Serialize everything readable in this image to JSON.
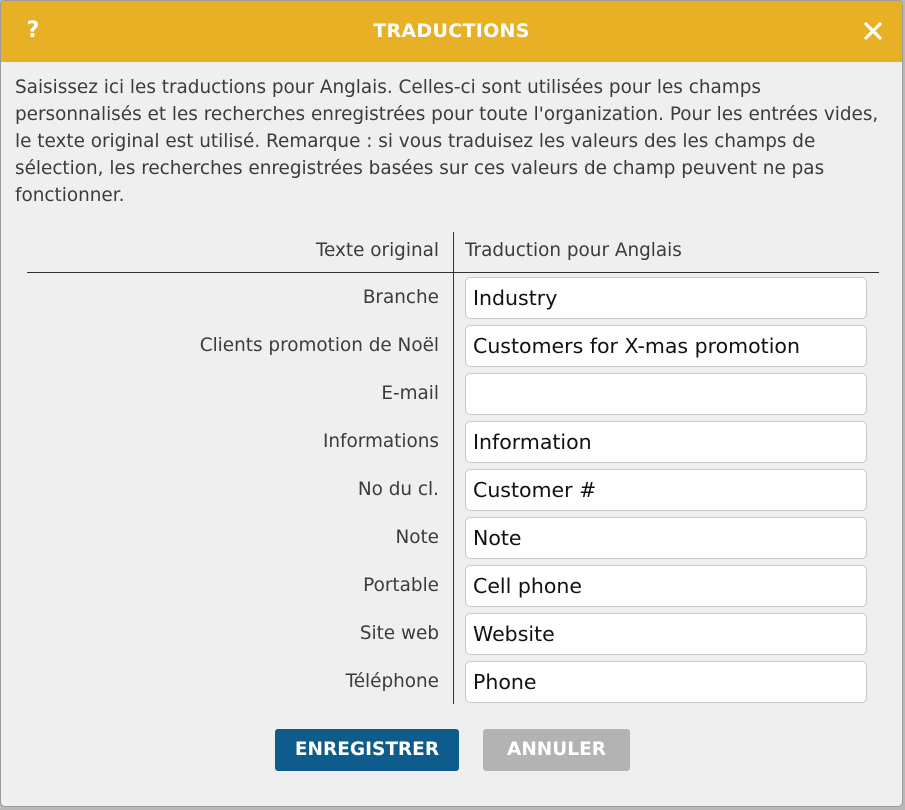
{
  "dialog": {
    "title": "TRADUCTIONS",
    "help_label": "?",
    "intro": "Saisissez ici les traductions pour Anglais. Celles-ci sont utilisées pour les champs personnalisés et les recherches enregistrées pour toute l'organization. Pour les entrées vides, le texte original est utilisé. Remarque : si vous traduisez les valeurs des les champs de sélection, les recherches enregistrées basées sur ces valeurs de champ peuvent ne pas fonctionner.",
    "accent_color": "#e8b024"
  },
  "table": {
    "header_original": "Texte original",
    "header_translation": "Traduction pour Anglais",
    "rows": [
      {
        "original": "Branche",
        "translation": "Industry"
      },
      {
        "original": "Clients promotion de Noël",
        "translation": "Customers for X-mas promotion"
      },
      {
        "original": "E-mail",
        "translation": ""
      },
      {
        "original": "Informations",
        "translation": "Information"
      },
      {
        "original": "No du cl.",
        "translation": "Customer #"
      },
      {
        "original": "Note",
        "translation": "Note"
      },
      {
        "original": "Portable",
        "translation": "Cell phone"
      },
      {
        "original": "Site web",
        "translation": "Website"
      },
      {
        "original": "Téléphone",
        "translation": "Phone"
      }
    ]
  },
  "buttons": {
    "save_label": "ENREGISTRER",
    "cancel_label": "ANNULER",
    "save_color": "#0d5c8c",
    "cancel_color": "#b3b3b3"
  }
}
